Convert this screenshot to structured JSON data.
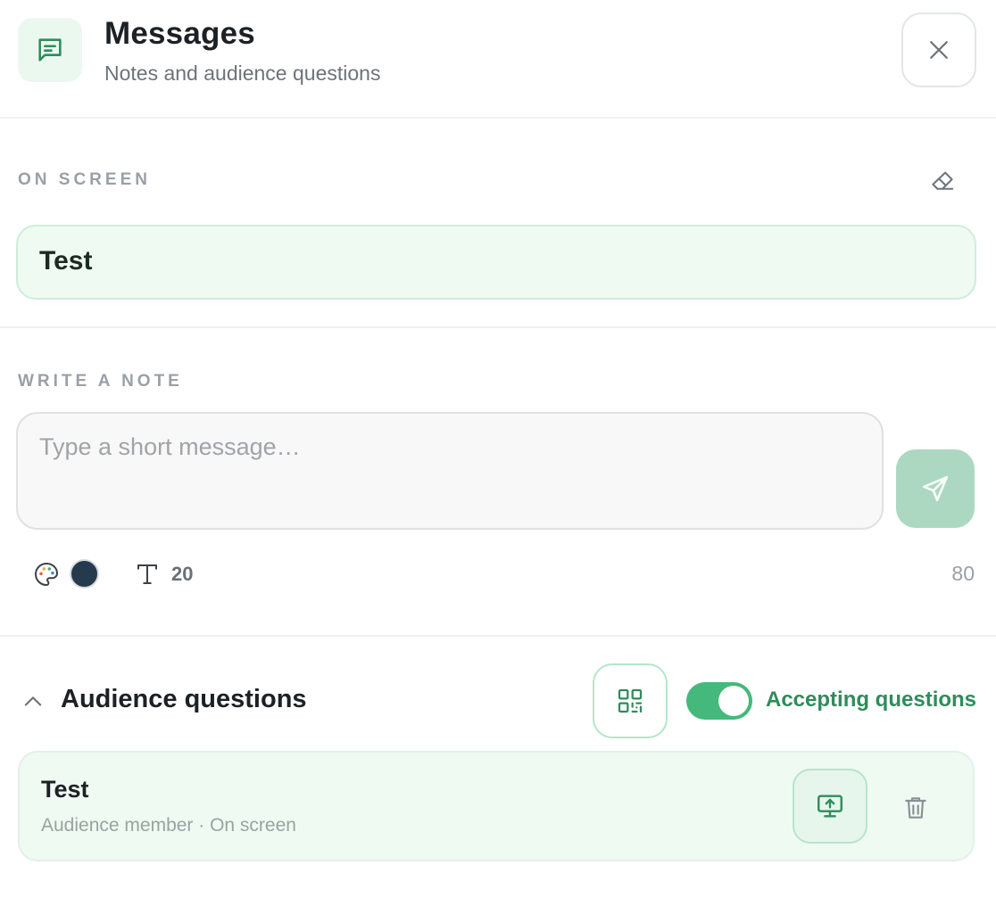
{
  "header": {
    "title": "Messages",
    "subtitle": "Notes and audience questions",
    "icon": "message-square-icon",
    "close_icon": "close-icon"
  },
  "on_screen": {
    "label": "ON SCREEN",
    "clear_icon": "eraser-icon",
    "current_text": "Test"
  },
  "write_note": {
    "label": "WRITE A NOTE",
    "input_value": "",
    "placeholder": "Type a short message…",
    "send_icon": "send-icon",
    "palette_icon": "palette-icon",
    "color": "#263a4e",
    "text_size_icon": "type-icon",
    "text_size": "20",
    "char_count": "80"
  },
  "audience": {
    "title": "Audience questions",
    "collapse_icon": "chevron-up-icon",
    "qr_icon": "qr-code-icon",
    "accepting": true,
    "accepting_label": "Accepting questions",
    "questions": [
      {
        "text": "Test",
        "meta": "Audience member · On screen",
        "present_icon": "screen-share-icon",
        "delete_icon": "trash-icon"
      }
    ]
  },
  "colors": {
    "accent": "#45b87b",
    "accent_text": "#2f8c5c",
    "accent_light": "#eefaf2",
    "send_disabled": "#acd8c2"
  }
}
